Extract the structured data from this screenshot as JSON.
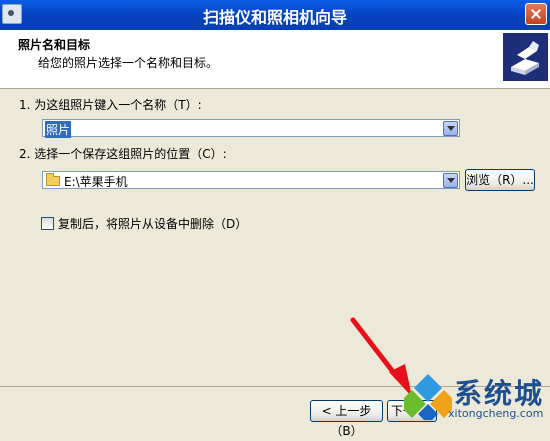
{
  "window": {
    "title": "扫描仪和照相机向导"
  },
  "header": {
    "title": "照片名和目标",
    "subtitle": "给您的照片选择一个名称和目标。"
  },
  "step1": {
    "label": "1. 为这组照片键入一个名称（T）:",
    "value": "照片"
  },
  "step2": {
    "label": "2. 选择一个保存这组照片的位置（C）:",
    "value": "E:\\苹果手机",
    "browse_label": "浏览（R）..."
  },
  "option": {
    "delete_after_copy": "复制后，将照片从设备中删除（D）",
    "checked": false
  },
  "footer": {
    "back_label": "< 上一步（B）",
    "next_label": "下一"
  },
  "watermark": {
    "text": "系统城",
    "url": "xitongcheng.com"
  },
  "colors": {
    "titlebar": "#0842c2",
    "selection": "#316ac5",
    "arrow": "#e8101a"
  }
}
